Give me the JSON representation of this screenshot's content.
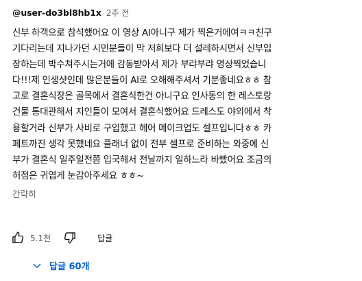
{
  "comment": {
    "author": "@user-do3bl8hb1x",
    "timestamp": "2주 전",
    "lines": [
      "신부 하객으로 참석했어요 이 영상 AI아니구 제가 찍은거에여ㅋㅋ친구",
      "기다리는데 지나가던 시민분들이 막 저희보다 더 설레하시면서 신부입",
      "장하는데 박수쳐주시는거에 감동받아서 제가 부랴부랴 영상찍었습니",
      "다!!!제 인생샷인데 많은분들이 AI로 오해해주셔서 기분좋네요ㅎㅎ 참",
      "고로 결혼식장은 골목에서 결혼식한건 아니구요 인사동의 한 레스토랑",
      "건물 통대관해서 지인들이 모여서 결혼식했어요 드레스도 야외에서 착",
      "용할거라 신부가 사비로 구입했고 헤어 메이크업도 셀프입니다ㅎㅎ 카",
      "페트까진 생각 못했네요 플래너 없이 전부 셀프로 준비하는 와중에 신",
      "부가 결혼식 일주일전쯤 입국해서 전날까지 일하느라 바빴어요 조금의",
      "허점은 귀엽게 눈감아주세요 ㅎㅎ~"
    ],
    "read_less_label": "간략히",
    "like_count": "5.1천",
    "reply_label": "답글",
    "replies_label": "답글 60개"
  },
  "icons": {
    "like": "thumbs-up-icon",
    "dislike": "thumbs-down-icon",
    "expand": "chevron-down-icon"
  },
  "colors": {
    "text": "#0f0f0f",
    "secondary": "#606060",
    "link": "#065fd4"
  }
}
